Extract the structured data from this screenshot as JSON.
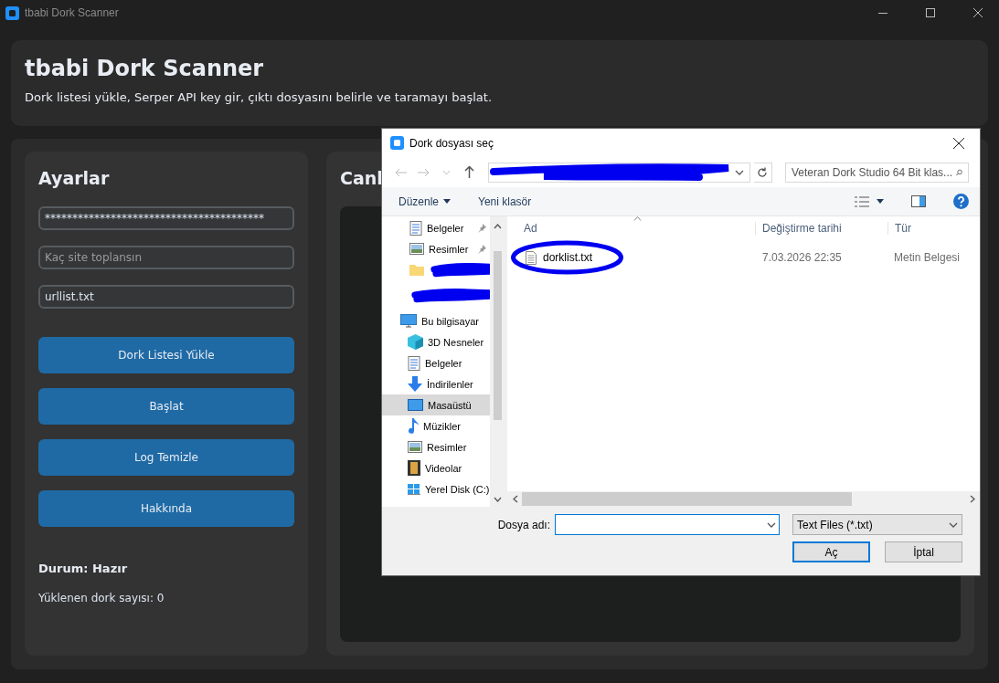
{
  "window": {
    "title": "tbabi Dork Scanner"
  },
  "header": {
    "title": "tbabi Dork Scanner",
    "subtitle": "Dork listesi yükle, Serper API key gir, çıktı dosyasını belirle ve taramayı başlat."
  },
  "settings": {
    "title": "Ayarlar",
    "fields": [
      {
        "value": "****************************************"
      },
      {
        "placeholder": "Kaç site toplansın"
      },
      {
        "value": "urllist.txt"
      }
    ],
    "buttons": [
      "Dork Listesi Yükle",
      "Başlat",
      "Log Temizle",
      "Hakkında"
    ],
    "status": "Durum: Hazır",
    "count": "Yüklenen dork sayısı: 0"
  },
  "log_panel": {
    "title": "Canl"
  },
  "dialog": {
    "title": "Dork dosyası seç",
    "address": {
      "redacted": true
    },
    "search": {
      "placeholder": "Veteran Dork Studio 64 Bit klas..."
    },
    "toolbar": {
      "organize": "Düzenle",
      "new_folder": "Yeni klasör"
    },
    "nav": [
      {
        "kind": "document",
        "label": "Belgeler",
        "pinned": true,
        "selected": false
      },
      {
        "kind": "picture",
        "label": "Resimler",
        "pinned": true,
        "selected": false
      },
      {
        "kind": "folder",
        "redacted": true,
        "selected": false
      },
      {
        "kind": "blank",
        "redacted": true,
        "selected": false
      },
      {
        "kind": "pc",
        "label": "Bu bilgisayar",
        "selected": false,
        "children": [
          {
            "kind": "cube",
            "label": "3D Nesneler",
            "selected": false
          },
          {
            "kind": "document",
            "label": "Belgeler",
            "selected": false
          },
          {
            "kind": "download",
            "label": "İndirilenler",
            "selected": false
          },
          {
            "kind": "desktop",
            "label": "Masaüstü",
            "selected": true
          },
          {
            "kind": "music",
            "label": "Müzikler",
            "selected": false
          },
          {
            "kind": "picture",
            "label": "Resimler",
            "selected": false
          },
          {
            "kind": "video",
            "label": "Videolar",
            "selected": false
          },
          {
            "kind": "drive",
            "label": "Yerel Disk (C:)",
            "selected": false
          }
        ]
      }
    ],
    "columns": [
      "Ad",
      "Değiştirme tarihi",
      "Tür"
    ],
    "files": [
      {
        "name": "dorklist.txt",
        "modified": "7.03.2026 22:35",
        "type": "Metin Belgesi",
        "circled": true
      }
    ],
    "filename_label": "Dosya adı:",
    "filter": "Text Files (*.txt)",
    "open_button": "Aç",
    "cancel_button": "İptal"
  }
}
